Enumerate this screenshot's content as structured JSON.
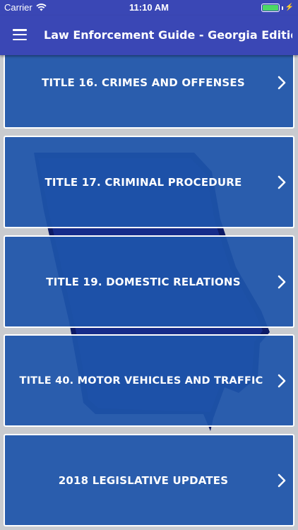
{
  "status_bar": {
    "carrier": "Carrier",
    "time": "11:10 AM",
    "battery_level": 1.0,
    "battery_color": "#4cd964"
  },
  "nav": {
    "title": "Law Enforcement Guide - Georgia Edition",
    "menu_icon": "hamburger-menu-icon"
  },
  "background": {
    "icon": "georgia-state-map",
    "color": "#0d1b66"
  },
  "colors": {
    "bar": "#3a47b5",
    "tile": "#1e54aa",
    "tile_border": "#ffffff",
    "page_bg": "#c9cbcf"
  },
  "items": [
    {
      "label": "TITLE 16.  CRIMES AND OFFENSES",
      "icon": "chevron-right-icon"
    },
    {
      "label": "TITLE 17. CRIMINAL PROCEDURE",
      "icon": "chevron-right-icon"
    },
    {
      "label": "TITLE 19. DOMESTIC RELATIONS",
      "icon": "chevron-right-icon"
    },
    {
      "label": "TITLE 40.  MOTOR VEHICLES AND TRAFFIC",
      "icon": "chevron-right-icon"
    },
    {
      "label": "2018 LEGISLATIVE UPDATES",
      "icon": "chevron-right-icon"
    }
  ]
}
